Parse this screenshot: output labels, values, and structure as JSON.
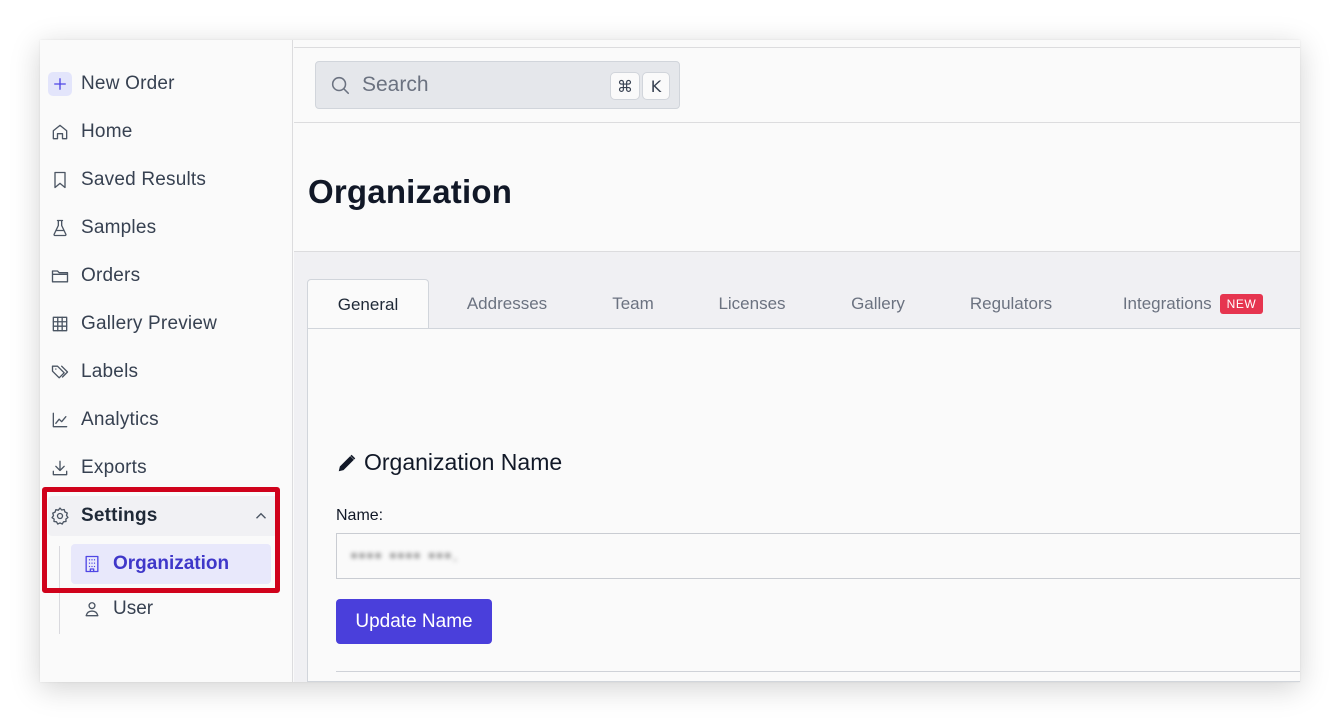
{
  "sidebar": {
    "items": [
      {
        "label": "New Order",
        "icon": "plus-icon"
      },
      {
        "label": "Home",
        "icon": "home-icon"
      },
      {
        "label": "Saved Results",
        "icon": "bookmark-icon"
      },
      {
        "label": "Samples",
        "icon": "flask-icon"
      },
      {
        "label": "Orders",
        "icon": "folder-icon"
      },
      {
        "label": "Gallery Preview",
        "icon": "table-icon"
      },
      {
        "label": "Labels",
        "icon": "tags-icon"
      },
      {
        "label": "Analytics",
        "icon": "chart-icon"
      },
      {
        "label": "Exports",
        "icon": "download-icon"
      },
      {
        "label": "Settings",
        "icon": "gear-icon"
      }
    ],
    "settings_sub": [
      {
        "label": "Organization",
        "icon": "building-icon"
      },
      {
        "label": "User",
        "icon": "user-icon"
      }
    ]
  },
  "search": {
    "placeholder": "Search",
    "shortcut_keys": [
      "⌘",
      "K"
    ]
  },
  "page": {
    "title": "Organization"
  },
  "tabs": [
    {
      "label": "General"
    },
    {
      "label": "Addresses"
    },
    {
      "label": "Team"
    },
    {
      "label": "Licenses"
    },
    {
      "label": "Gallery"
    },
    {
      "label": "Regulators"
    },
    {
      "label": "Integrations",
      "badge": "NEW"
    }
  ],
  "org_name_section": {
    "title": "Organization Name",
    "field_label": "Name:",
    "field_value": "▪▪▪▪ ▪▪▪▪ ▪▪▪.",
    "button_label": "Update Name"
  },
  "colors": {
    "accent": "#4a3fdb",
    "highlight_box": "#d0021b",
    "badge_new": "#e6354f"
  }
}
